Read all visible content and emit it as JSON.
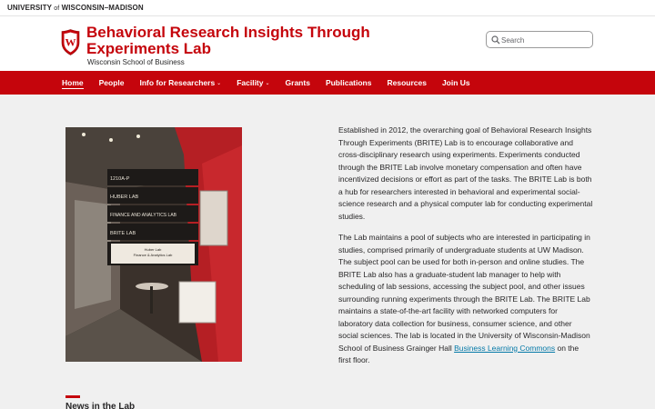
{
  "topbar": {
    "uw_pre": "UNIVERSITY",
    "uw_of": "of",
    "uw_post": "WISCONSIN–MADISON"
  },
  "header": {
    "title": "Behavioral Research Insights Through Experiments Lab",
    "subtitle": "Wisconsin School of Business",
    "crest_letter": "W"
  },
  "search": {
    "placeholder": "Search",
    "value": ""
  },
  "nav": {
    "items": [
      {
        "label": "Home",
        "active": true
      },
      {
        "label": "People"
      },
      {
        "label": "Info for Researchers",
        "dropdown": true
      },
      {
        "label": "Facility",
        "dropdown": true
      },
      {
        "label": "Grants"
      },
      {
        "label": "Publications"
      },
      {
        "label": "Resources"
      },
      {
        "label": "Join Us"
      }
    ],
    "chevron": "⌄"
  },
  "photo": {
    "sign": {
      "room": "1210A-P",
      "line1": "HUBER LAB",
      "line2": "FINANCE AND ANALYTICS LAB",
      "line3": "BRITE LAB",
      "plaque1": "Huber Lab",
      "plaque2": "Finance & Analytics Lab"
    }
  },
  "content": {
    "p1": "Established in 2012, the overarching goal of Behavioral Research Insights Through Experiments (BRITE) Lab is to encourage collaborative and cross-disciplinary research using experiments. Experiments conducted through the BRITE Lab involve monetary compensation and often have incentivized decisions or effort as part of the tasks. The BRITE Lab is both a hub for researchers interested in behavioral and experimental social-science research and a physical computer lab for conducting experimental studies.",
    "p2_before": "The Lab maintains a pool of subjects who are interested in participating in studies, comprised primarily of undergraduate students at UW Madison. The subject pool can be used for both in-person and online studies. The BRITE Lab also has a graduate-student lab manager to help with scheduling of lab sessions, accessing the subject pool, and other issues surrounding running experiments through the BRITE Lab. The BRITE Lab maintains a state-of-the-art facility with networked computers for laboratory data collection for business, consumer science, and other social sciences. The lab is located in the University of Wisconsin-Madison School of Business Grainger Hall ",
    "p2_link": "Business Learning Commons",
    "p2_after": " on the first floor."
  },
  "news": {
    "heading": "News in the Lab"
  },
  "colors": {
    "brand_red": "#c5050c",
    "link": "#0479a8",
    "text": "#282728",
    "background": "#f0f0f0"
  }
}
